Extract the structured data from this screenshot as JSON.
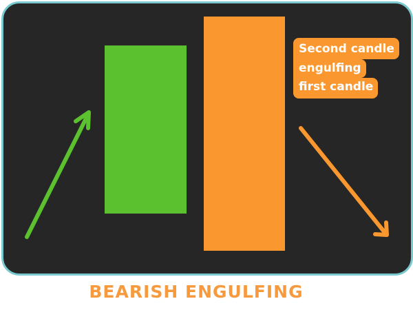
{
  "diagram": {
    "title": "BEARISH ENGULFING",
    "callout_lines": [
      "Second candle",
      "engulfing",
      "first candle"
    ],
    "colors": {
      "panel_background": "#262626",
      "panel_border": "#79c9cf",
      "bullish": "#5cc12e",
      "bearish": "#fa972f",
      "title": "#f79a3e",
      "callout_text": "#ffffff"
    },
    "candles": [
      {
        "name": "first-candle",
        "direction": "bullish",
        "color": "#5cc12e"
      },
      {
        "name": "second-candle",
        "direction": "bearish",
        "color": "#fa972f"
      }
    ],
    "trend_arrows": [
      {
        "name": "uptrend-arrow",
        "direction": "up",
        "color": "#5cc12e"
      },
      {
        "name": "downtrend-arrow",
        "direction": "down",
        "color": "#fa972f"
      }
    ]
  }
}
